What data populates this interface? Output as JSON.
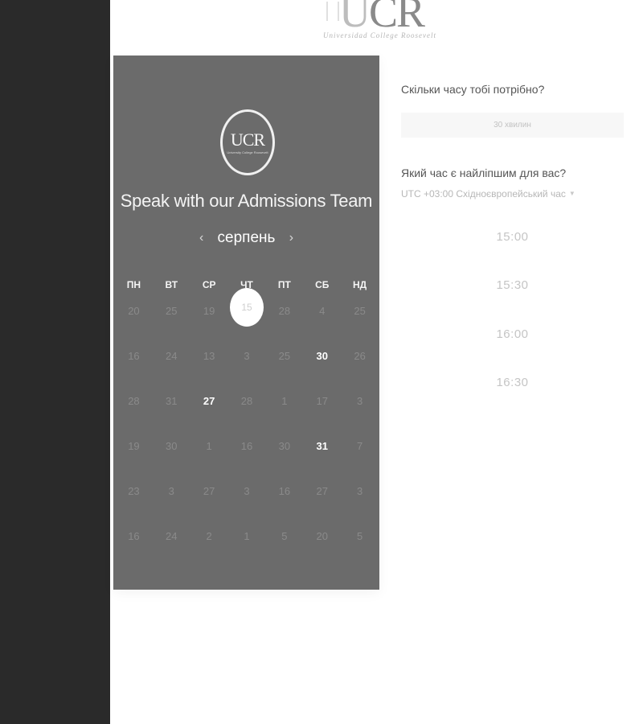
{
  "logo": {
    "letters_u": "U",
    "letters_cr": "CR",
    "tagline": "Universidad College Roosevelt"
  },
  "calendar": {
    "logo_text": "UCR",
    "logo_sub": "University College Roosevelt",
    "title": "Speak with our Admissions Team",
    "prev_label": "‹",
    "month": "серпень",
    "next_label": "›",
    "weekdays": [
      "ПН",
      "ВТ",
      "СР",
      "ЧТ",
      "ПТ",
      "СБ",
      "НД"
    ],
    "selected_day": "15",
    "weeks": [
      [
        "20",
        "25",
        "19",
        "15",
        "28",
        "4",
        "25"
      ],
      [
        "16",
        "24",
        "13",
        "3",
        "25",
        "30",
        "26"
      ],
      [
        "28",
        "31",
        "27",
        "28",
        "1",
        "17",
        "3"
      ],
      [
        "19",
        "30",
        "1",
        "16",
        "30",
        "31",
        "7"
      ],
      [
        "23",
        "3",
        "27",
        "3",
        "16",
        "27",
        "3"
      ],
      [
        "16",
        "24",
        "2",
        "1",
        "5",
        "20",
        "5"
      ]
    ],
    "available_days": [
      "30",
      "27",
      "31"
    ]
  },
  "booking": {
    "duration_question": "Скільки часу тобі потрібно?",
    "duration_value": "30 хвилин",
    "time_question": "Який час є найліпшим для вас?",
    "timezone": "UTC +03:00 Східноєвропейський час",
    "slots": [
      "15:00",
      "15:30",
      "16:00",
      "16:30"
    ]
  }
}
